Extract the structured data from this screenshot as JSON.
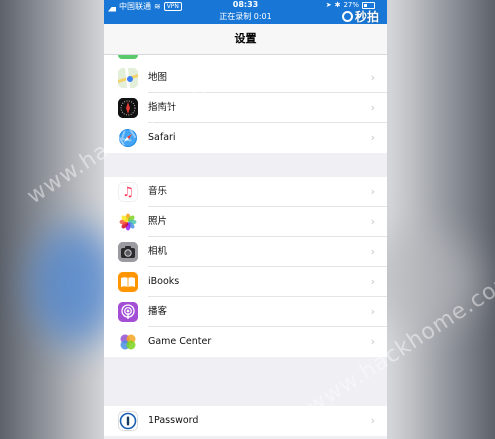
{
  "status_bar": {
    "carrier": "中国联通",
    "vpn": "VPN",
    "time": "08:33",
    "recording": "正在录制 0:01",
    "battery_percent": "27%",
    "logo_text": "秒拍"
  },
  "navbar": {
    "title": "设置"
  },
  "groups": [
    {
      "items": [
        {
          "label": "地图",
          "icon": "maps-icon",
          "color": "#e8f1e6"
        },
        {
          "label": "指南针",
          "icon": "compass-icon",
          "color": "#111111"
        },
        {
          "label": "Safari",
          "icon": "safari-icon",
          "color": "#ffffff"
        }
      ]
    },
    {
      "items": [
        {
          "label": "音乐",
          "icon": "music-icon",
          "color": "#ffffff"
        },
        {
          "label": "照片",
          "icon": "photos-icon",
          "color": "#ffffff"
        },
        {
          "label": "相机",
          "icon": "camera-icon",
          "color": "#8e8e93"
        },
        {
          "label": "iBooks",
          "icon": "ibooks-icon",
          "color": "#ff9500"
        },
        {
          "label": "播客",
          "icon": "podcasts-icon",
          "color": "#9b4dca"
        },
        {
          "label": "Game Center",
          "icon": "game-center-icon",
          "color": "#ffffff"
        }
      ]
    },
    {
      "items": [
        {
          "label": "1Password",
          "icon": "onepassword-icon",
          "color": "#ffffff"
        }
      ]
    }
  ],
  "watermark": "www.hackhome.com"
}
